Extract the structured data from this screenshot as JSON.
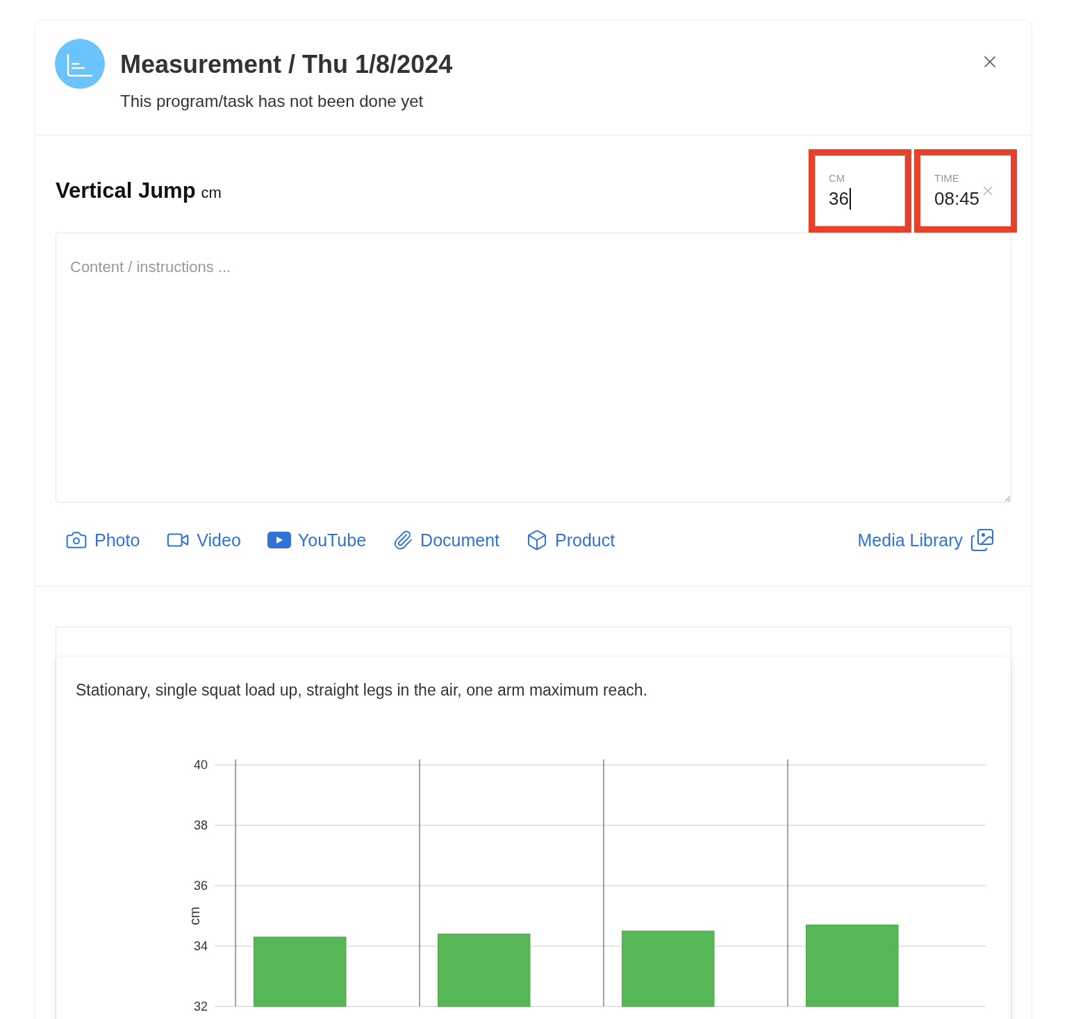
{
  "header": {
    "title": "Measurement / Thu 1/8/2024",
    "subtitle": "This program/task has not been done yet"
  },
  "exercise": {
    "name": "Vertical Jump",
    "unit": "cm"
  },
  "fields": [
    {
      "label": "CM",
      "value": "36",
      "focused": true,
      "clearable": false
    },
    {
      "label": "TIME",
      "value": "08:45",
      "focused": false,
      "clearable": true
    }
  ],
  "content": {
    "placeholder": "Content / instructions ..."
  },
  "media_buttons": [
    {
      "kind": "photo",
      "label": "Photo"
    },
    {
      "kind": "video",
      "label": "Video"
    },
    {
      "kind": "youtube",
      "label": "YouTube"
    },
    {
      "kind": "document",
      "label": "Document"
    },
    {
      "kind": "product",
      "label": "Product"
    }
  ],
  "media_library": {
    "label": "Media Library"
  },
  "description": "Stationary, single squat load up, straight legs in the air, one arm maximum reach.",
  "chart_data": {
    "type": "bar",
    "grid": true,
    "ylabel": "cm",
    "ylim": [
      32,
      40
    ],
    "yticks": [
      32,
      34,
      36,
      38,
      40
    ],
    "values": [
      34.3,
      34.4,
      34.5,
      34.7
    ]
  }
}
